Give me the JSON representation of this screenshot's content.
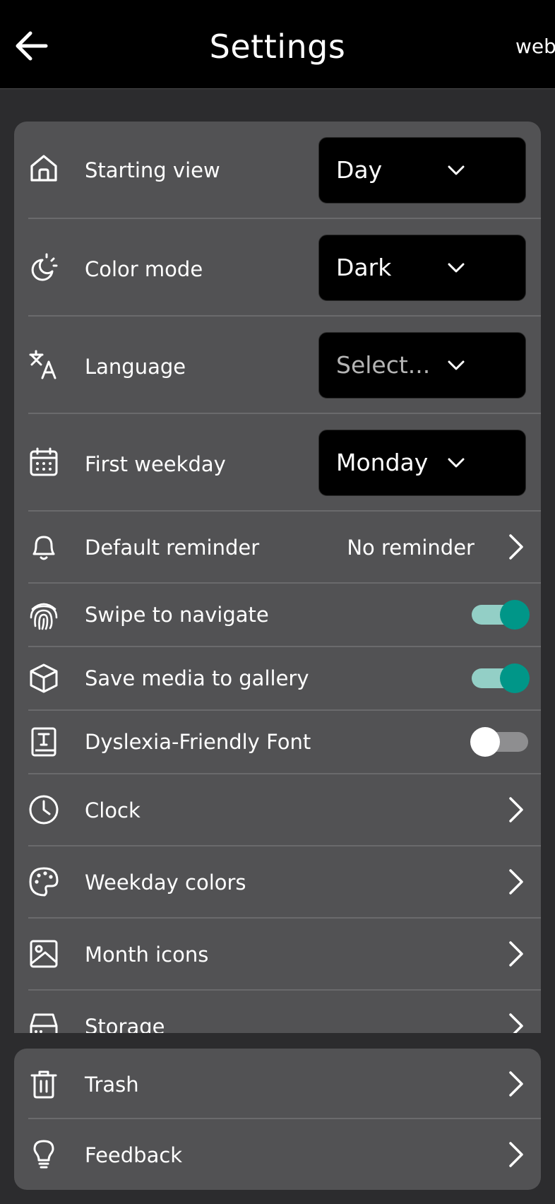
{
  "header": {
    "title": "Settings",
    "right_text": "web"
  },
  "colors": {
    "background": "#2c2c2e",
    "topbar": "#000000",
    "card": "#525254",
    "accent": "#009688",
    "accent_track": "#93cfc6"
  },
  "settings": {
    "starting_view": {
      "label": "Starting view",
      "value": "Day",
      "icon": "home-icon"
    },
    "color_mode": {
      "label": "Color mode",
      "value": "Dark",
      "icon": "theme-icon"
    },
    "language": {
      "label": "Language",
      "placeholder": "Select...",
      "icon": "translate-icon"
    },
    "first_weekday": {
      "label": "First weekday",
      "value": "Monday",
      "icon": "calendar-icon"
    },
    "default_reminder": {
      "label": "Default reminder",
      "value": "No reminder",
      "icon": "bell-icon"
    },
    "swipe_to_navigate": {
      "label": "Swipe to navigate",
      "enabled": true,
      "icon": "fingerprint-icon"
    },
    "save_media": {
      "label": "Save media to gallery",
      "enabled": true,
      "icon": "cube-icon"
    },
    "dyslexia_font": {
      "label": "Dyslexia-Friendly Font",
      "enabled": false,
      "icon": "font-book-icon"
    },
    "clock": {
      "label": "Clock",
      "icon": "clock-icon"
    },
    "weekday_colors": {
      "label": "Weekday colors",
      "icon": "palette-icon"
    },
    "month_icons": {
      "label": "Month icons",
      "icon": "image-icon"
    },
    "storage": {
      "label": "Storage",
      "icon": "storage-icon"
    }
  },
  "secondary": {
    "trash": {
      "label": "Trash",
      "icon": "trash-icon"
    },
    "feedback": {
      "label": "Feedback",
      "icon": "lightbulb-icon"
    }
  }
}
